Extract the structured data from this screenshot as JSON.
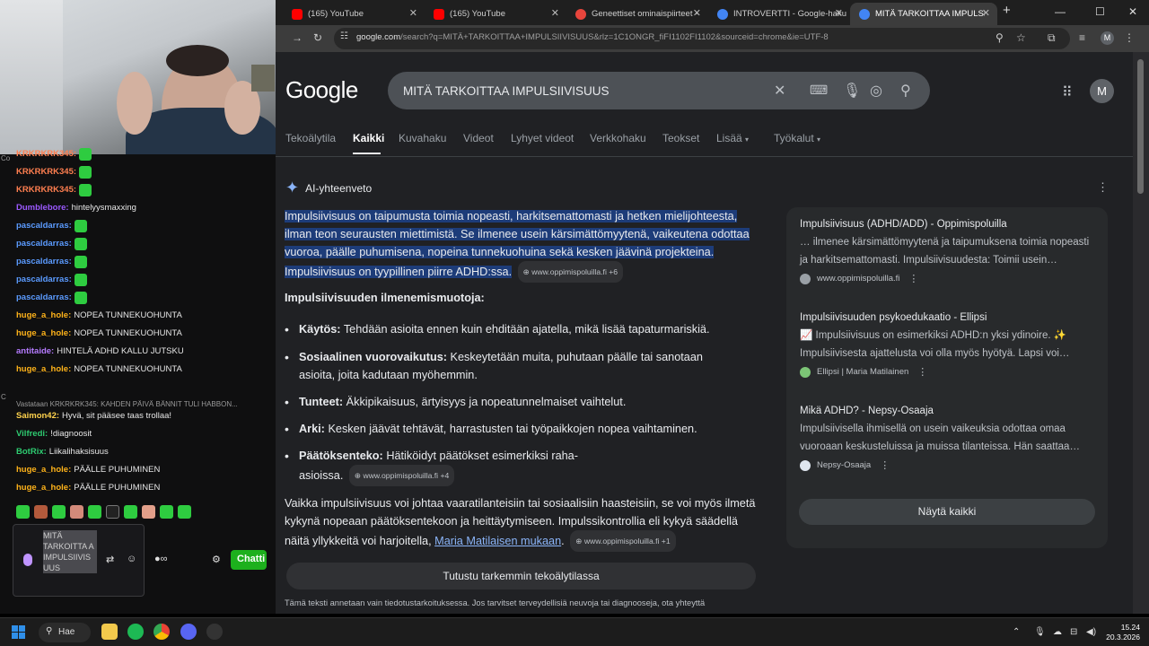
{
  "browser": {
    "tabs": [
      {
        "title": "(165) YouTube",
        "favicon_color": "#ff0000"
      },
      {
        "title": "(165) YouTube",
        "favicon_color": "#ff0000"
      },
      {
        "title": "Geneettiset ominaispiirteet - M",
        "favicon_color": "#e8453c"
      },
      {
        "title": "INTROVERTTI - Google-haku",
        "favicon_color": "#4285f4"
      },
      {
        "title": "MITÄ TARKOITTAA IMPULSIIVISUUS",
        "favicon_color": "#4285f4"
      }
    ],
    "url_host": "google.com",
    "url_rest": "/search?q=MITÄ+TARKOITTAA+IMPULSIIVISUUS&rlz=1C1ONGR_fiFI1102FI1102&sourceid=chrome&ie=UTF-8"
  },
  "google": {
    "logo": "Google",
    "query": "MITÄ TARKOITTAA IMPULSIIVISUUS",
    "avatar_letter": "M",
    "nav": [
      "Tekoälytila",
      "Kaikki",
      "Kuvahaku",
      "Videot",
      "Lyhyet videot",
      "Verkkohaku",
      "Teokset",
      "Lisää",
      "Työkalut"
    ],
    "ai": {
      "title": "AI-yhteenveto",
      "intro_highlight": "Impulsiivisuus on taipumusta toimia nopeasti, harkitsemattomasti ja hetken mielijohteesta, ilman teon seurausten miettimistä. Se ilmenee usein kärsimättömyytenä, vaikeutena odottaa vuoroa, päälle puhumisena, nopeina tunnekuohuina sekä kesken jäävinä projekteina. Impulsiivisuus on tyypillinen piirre ADHD:ssa.",
      "intro_source": "www.oppimispoluilla.fi +6",
      "subheading": "Impulsiivisuuden ilmenemismuotoja:",
      "bullets": [
        {
          "label": "Käytös:",
          "text": "Tehdään asioita ennen kuin ehditään ajatella, mikä lisää tapaturmariskiä."
        },
        {
          "label": "Sosiaalinen vuorovaikutus:",
          "text": "Keskeytetään muita, puhutaan päälle tai sanotaan asioita, joita kadutaan myöhemmin."
        },
        {
          "label": "Tunteet:",
          "text": "Äkkipikaisuus, ärtyisyys ja nopeatunnelmaiset vaihtelut."
        },
        {
          "label": "Arki:",
          "text": "Kesken jäävät tehtävät, harrastusten tai työpaikkojen nopea vaihtaminen."
        },
        {
          "label": "Päätöksenteko:",
          "text": "Hätiköidyt päätökset esimerkiksi raha-asioissa."
        }
      ],
      "bullets_source": "www.oppimispoluilla.fi +4",
      "outro": "Vaikka impulsiivisuus voi johtaa vaaratilanteisiin tai sosiaalisiin haasteisiin, se voi myös ilmetä kykynä nopeaan päätöksentekoon ja heittäytymiseen. Impulssikontrollia eli kykyä säädellä näitä yllykkeitä voi harjoitella,",
      "outro_link": "Maria Matilaisen mukaan",
      "outro_source": "www.oppimispoluilla.fi +1",
      "button": "Tutustu tarkemmin tekoälytilassa",
      "disclaimer": "Tämä teksti annetaan vain tiedotustarkoituksessa. Jos tarvitset terveydellisiä neuvoja tai diagnooseja, ota yhteyttä"
    },
    "sources": [
      {
        "title": "Impulsiivisuus (ADHD/ADD) - Oppimispoluilla",
        "text": "… ilmenee kärsimättömyytenä ja taipumuksena toimia nopeasti ja harkitsemattomasti. Impulsiivisuudesta: Toimii usein…",
        "site": "www.oppimispoluilla.fi"
      },
      {
        "title": "Impulsiivisuuden psykoedukaatio - Ellipsi",
        "text": "📈 Impulsiivisuus on esimerkiksi ADHD:n yksi ydinoire. ✨ Impulsiivisesta ajattelusta voi olla myös hyötyä. Lapsi voi…",
        "site": "Ellipsi | Maria Matilainen"
      },
      {
        "title": "Mikä ADHD? - Nepsy-Osaaja",
        "text": "Impulsiivisella ihmisellä on usein vaikeuksia odottaa omaa vuoroaan keskusteluissa ja muissa tilanteissa. Hän saattaa…",
        "site": "Nepsy-Osaaja"
      }
    ],
    "show_all": "Näytä kaikki"
  },
  "chat": {
    "messages": [
      {
        "user": "KRKRKRK345:",
        "color": "#ff7f50",
        "text": ""
      },
      {
        "user": "KRKRKRK345:",
        "color": "#ff7f50",
        "text": ""
      },
      {
        "user": "KRKRKRK345:",
        "color": "#ff7f50",
        "text": ""
      },
      {
        "user": "Dumblebore:",
        "color": "#9b59ff",
        "text": "hintelyysmaxxing"
      },
      {
        "user": "pascaldarras:",
        "color": "#5b9bff",
        "text": ""
      },
      {
        "user": "pascaldarras:",
        "color": "#5b9bff",
        "text": ""
      },
      {
        "user": "pascaldarras:",
        "color": "#5b9bff",
        "text": ""
      },
      {
        "user": "pascaldarras:",
        "color": "#5b9bff",
        "text": ""
      },
      {
        "user": "pascaldarras:",
        "color": "#5b9bff",
        "text": ""
      },
      {
        "user": "huge_a_hole:",
        "color": "#ffb31a",
        "text": "NOPEA TUNNEKUOHUNTA"
      },
      {
        "user": "huge_a_hole:",
        "color": "#ffb31a",
        "text": "NOPEA TUNNEKUOHUNTA"
      },
      {
        "user": "antitaide:",
        "color": "#b57bff",
        "text": "HINTELÄ ADHD KALLU JUTSKU"
      },
      {
        "user": "huge_a_hole:",
        "color": "#ffb31a",
        "text": "NOPEA TUNNEKUOHUNTA"
      }
    ],
    "reply_note": "Vastataan KRKRKRK345: KAHDEN PÄIVÄ BÄNNIT TULI HABBON...",
    "messages2": [
      {
        "user": "Saimon42:",
        "color": "#ffd24d",
        "text": "Hyvä, sit pääsee taas trollaa!"
      },
      {
        "user": "Vilfredi:",
        "color": "#2ecc71",
        "text": "!diagnoosit"
      },
      {
        "user": "BotRix:",
        "color": "#2ecc71",
        "text": "Liikalihaksisuus"
      },
      {
        "user": "huge_a_hole:",
        "color": "#ffb31a",
        "text": "PÄÄLLE PUHUMINEN"
      },
      {
        "user": "huge_a_hole:",
        "color": "#ffb31a",
        "text": "PÄÄLLE PUHUMINEN"
      }
    ],
    "input_text": "MITÄ TARKOITTA A IMPULSIIVIS UUS",
    "send_label": "Chatti",
    "side_label": "Co"
  },
  "taskbar": {
    "search_label": "Hae",
    "time": "15.24",
    "date": "20.3.2026"
  }
}
